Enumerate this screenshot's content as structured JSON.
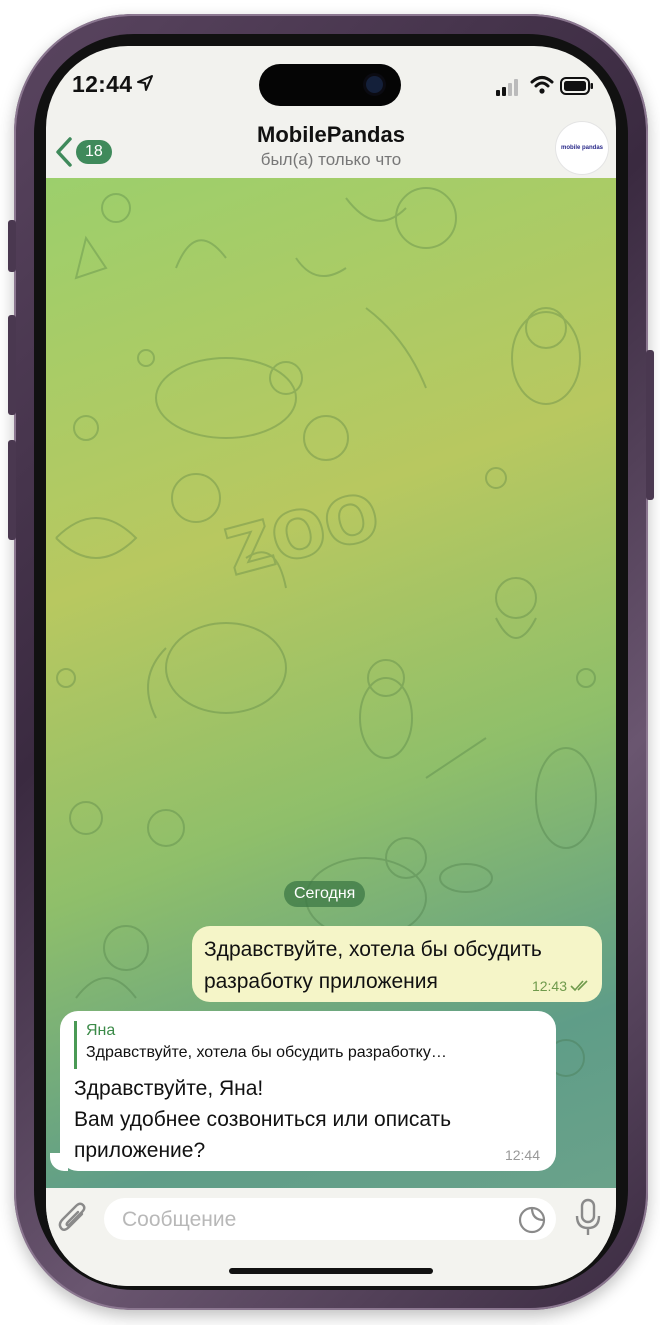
{
  "status_bar": {
    "time": "12:44"
  },
  "header": {
    "back_count": "18",
    "title": "MobilePandas",
    "subtitle": "был(а) только что",
    "avatar_text": "mobile pandas"
  },
  "chat": {
    "background_word": "ZOO",
    "date_label": "Сегодня",
    "messages": [
      {
        "direction": "outgoing",
        "text_line1": "Здравствуйте, хотела бы обсудить",
        "text_line2": "разработку приложения",
        "time": "12:43",
        "status": "read"
      },
      {
        "direction": "incoming",
        "reply_name": "Яна",
        "reply_text": "Здравствуйте, хотела бы обсудить разработку…",
        "text_line1": "Здравствуйте, Яна!",
        "text_line2": "Вам удобнее созвониться или описать",
        "text_line3": "приложение?",
        "time": "12:44"
      }
    ]
  },
  "composer": {
    "placeholder": "Сообщение"
  },
  "colors": {
    "accent": "#3f8a5b",
    "outgoing_bubble": "#f5f5c8",
    "incoming_bubble": "#ffffff"
  }
}
